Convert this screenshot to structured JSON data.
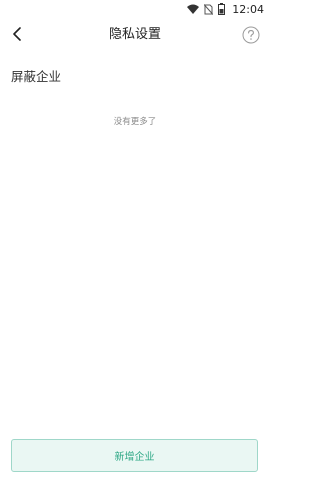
{
  "status_bar": {
    "time": "12:04",
    "icons": [
      "wifi-icon",
      "no-sim-icon",
      "battery-icon"
    ]
  },
  "nav": {
    "title": "隐私设置",
    "back_icon": "chevron-left-icon",
    "help_icon": "help-circle-icon"
  },
  "section": {
    "title": "屏蔽企业",
    "empty_text": "没有更多了"
  },
  "footer": {
    "add_button_label": "新增企业"
  },
  "colors": {
    "accent": "#2fa886",
    "button_bg": "#eaf7f3",
    "button_border": "#9fd7c9"
  }
}
